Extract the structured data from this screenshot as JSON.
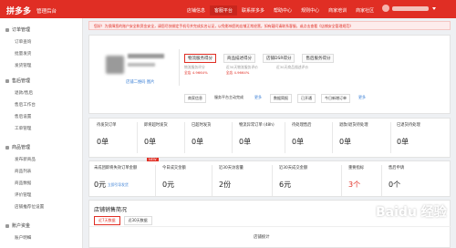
{
  "app": {
    "logo_text": "拼多多",
    "subtitle": "管理后台"
  },
  "nav": {
    "items": [
      "店铺信息",
      "客服平台",
      "联系拼多多",
      "帮助中心",
      "规则中心",
      "商家培训",
      "商家社区"
    ],
    "active_index": 1
  },
  "sidebar": {
    "sections": [
      {
        "title": "订单管理",
        "items": [
          "订单查询",
          "批量发货",
          "发货管理"
        ]
      },
      {
        "title": "售后管理",
        "items": [
          "退款/售后",
          "售后工作台",
          "售后设置",
          "工单管理"
        ]
      },
      {
        "title": "商品管理",
        "items": [
          "发布新商品",
          "商品列表",
          "商品数据",
          "评价管理",
          "店铺推荐位设置"
        ]
      },
      {
        "title": "账户资金",
        "items": [
          "账户明细"
        ]
      }
    ]
  },
  "notice": {
    "text": "您好！为保障您的账户安全和资金安全，请您尽快绑定手机号并完成实名认证，以免影响您的店铺正常经营，如有疑问请联系客服，或点击查看《店铺安全管理规范》"
  },
  "store": {
    "link_text": "店铺二维码 图片",
    "scores": [
      "物流服务得分",
      "商品描述得分",
      "店铺DSR得分",
      "售后服务得分"
    ],
    "ratings": [
      {
        "label": "物流服务评分",
        "line2": "全店 4.9664%"
      },
      {
        "label": "近30天物流服务评价",
        "line2": "全店 4.9664%"
      },
      {
        "label": "近30天商品描述评价",
        "line2": ""
      }
    ],
    "pill_label": "商家信息",
    "status_text": "服务平台主动完成",
    "pills_right": [
      "数据简报",
      "已开通",
      "今日新增订单"
    ],
    "more": "更多"
  },
  "stats": [
    {
      "label": "待发货订单",
      "value": "0单"
    },
    {
      "label": "即将超时发货",
      "value": "0单"
    },
    {
      "label": "已超时发货",
      "value": "0单"
    },
    {
      "label": "物流异常订单 (48h)",
      "value": "0单"
    },
    {
      "label": "待处理售后",
      "value": "0单"
    },
    {
      "label": "退款/退货待处理",
      "value": "0单"
    },
    {
      "label": "已退货待处理",
      "value": "0单"
    }
  ],
  "metrics": {
    "new_badge": "NEW",
    "link": "立即引导发货",
    "items": [
      {
        "label": "未成团即将失效订单金额",
        "value": "0元"
      },
      {
        "label": "今日成交金额",
        "value": "0元"
      },
      {
        "label": "近30天访客量",
        "value": "2份"
      },
      {
        "label": "近30天成交金额",
        "value": "6元"
      },
      {
        "label": "重要指标",
        "value": "3个",
        "highlight": true
      },
      {
        "label": "售后申请",
        "value": "0个"
      }
    ]
  },
  "chart": {
    "title": "店铺销售简况",
    "tabs": [
      "近7天数据",
      "近30天数据"
    ],
    "label": "店铺统计"
  },
  "watermark": "Baidu 经验"
}
